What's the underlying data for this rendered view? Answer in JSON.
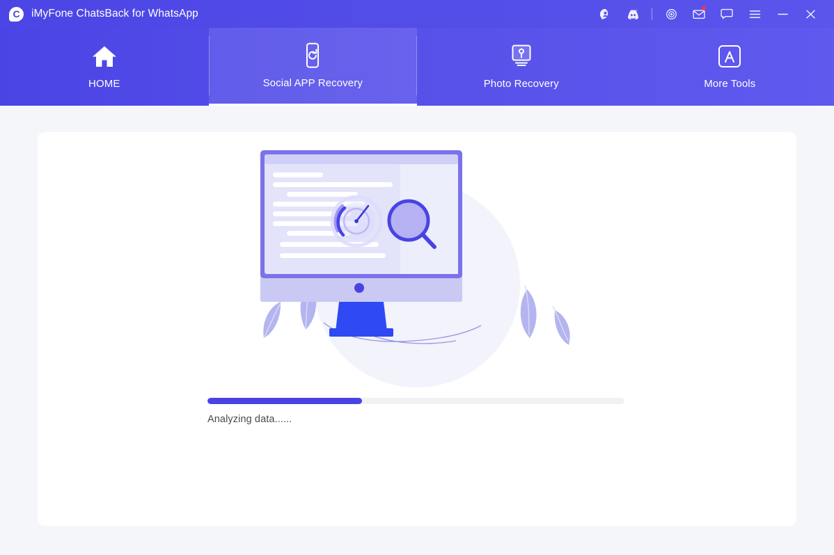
{
  "window": {
    "title": "iMyFone ChatsBack for WhatsApp",
    "logo_icon": "chatsback-logo-icon",
    "controls": [
      {
        "name": "account-icon",
        "label": "Account"
      },
      {
        "name": "discord-icon",
        "label": "Discord"
      },
      {
        "name": "target-icon",
        "label": "Record"
      },
      {
        "name": "mail-icon",
        "label": "Messages",
        "badge": true
      },
      {
        "name": "feedback-icon",
        "label": "Feedback"
      },
      {
        "name": "menu-icon",
        "label": "Menu"
      },
      {
        "name": "minimize-icon",
        "label": "Minimize"
      },
      {
        "name": "close-icon",
        "label": "Close"
      }
    ]
  },
  "nav": {
    "tabs": [
      {
        "label": "HOME",
        "icon": "home-icon",
        "active": false
      },
      {
        "label": "Social APP Recovery",
        "icon": "phone-refresh-icon",
        "active": true
      },
      {
        "label": "Photo Recovery",
        "icon": "monitor-photo-icon",
        "active": false
      },
      {
        "label": "More Tools",
        "icon": "app-store-icon",
        "active": false
      }
    ]
  },
  "main": {
    "illustration": "analyzing-monitor-illustration",
    "progress": {
      "percent": 37,
      "status_text": "Analyzing data......"
    }
  },
  "colors": {
    "brand_purple": "#4c45e6",
    "progress_fill": "#4a43e4",
    "track": "#f0f1f3",
    "page_bg": "#f5f6fa",
    "card_bg": "#ffffff",
    "badge_red": "#f5344a"
  }
}
